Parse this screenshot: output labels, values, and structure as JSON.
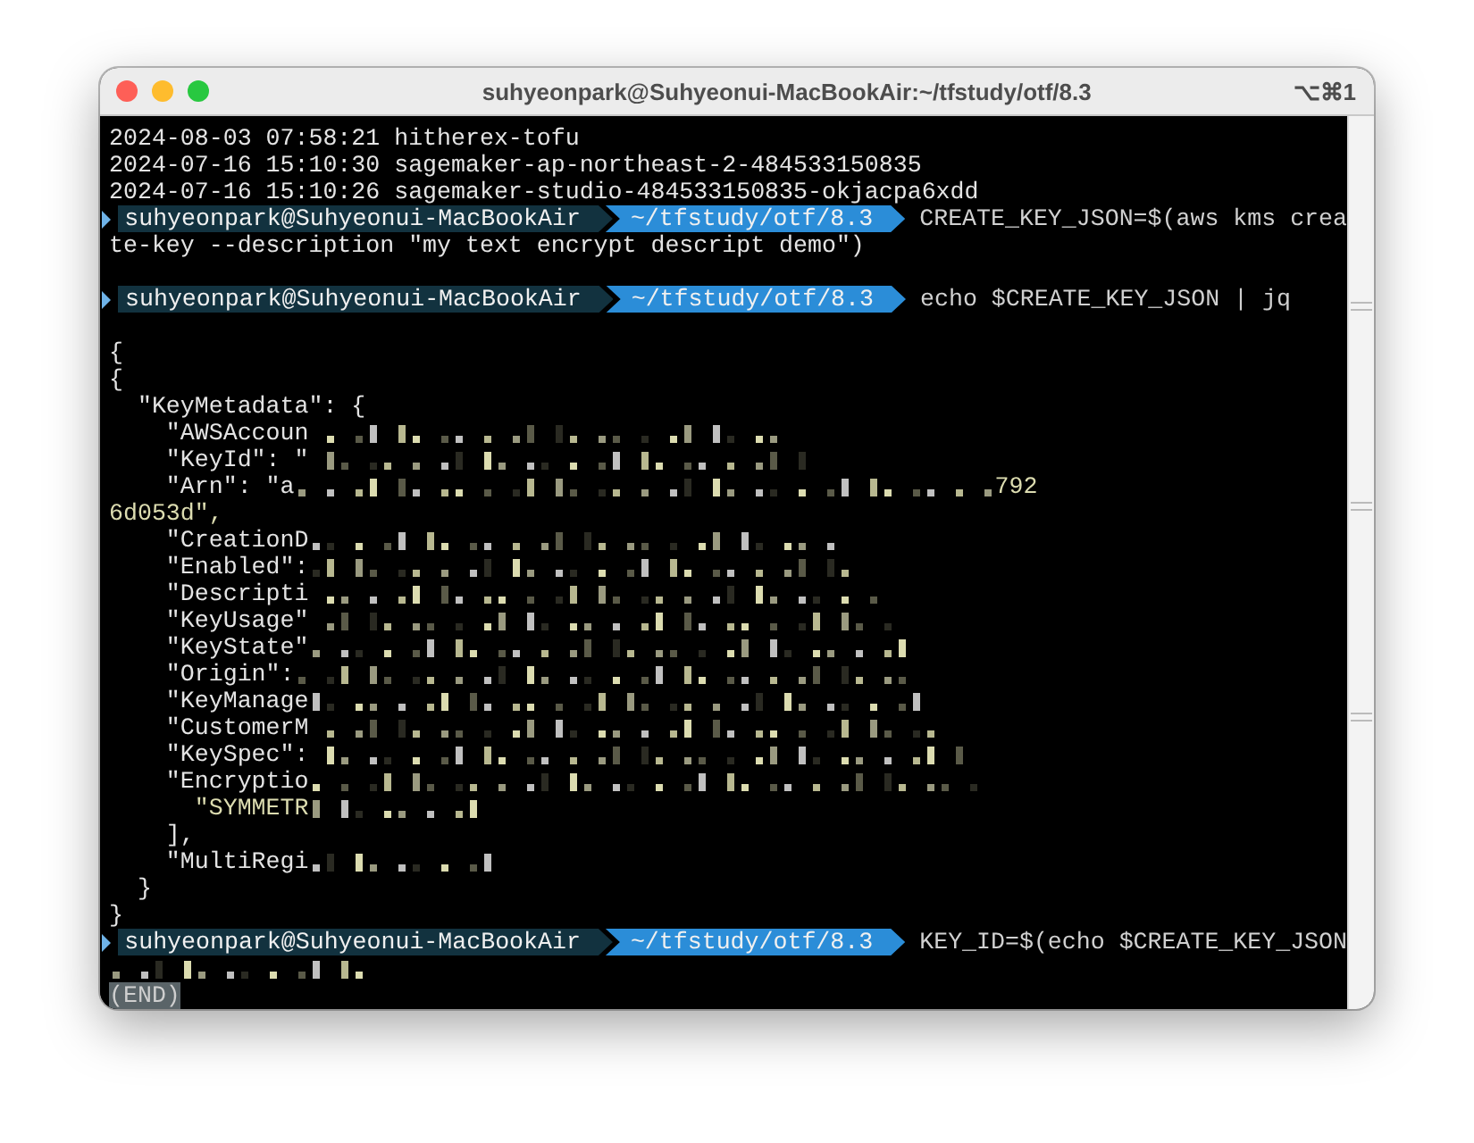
{
  "window": {
    "title": "suhyeonpark@Suhyeonui-MacBookAir:~/tfstudy/otf/8.3",
    "shortcut": "⌥⌘1"
  },
  "lines": [
    {
      "kind": "text",
      "text": "2024-08-03 07:58:21 hitherex-tofu",
      "highlighted": false
    },
    {
      "kind": "text",
      "text": "2024-07-16 15:10:30 sagemaker-ap-northeast-2-484533150835",
      "highlighted": false
    },
    {
      "kind": "text",
      "text": "2024-07-16 15:10:26 sagemaker-studio-484533150835-okjacpa6xdd",
      "highlighted": false
    },
    {
      "kind": "prompt",
      "user": "suhyeonpark@Suhyeonui-MacBookAir",
      "path": "~/tfstudy/otf/8.3",
      "command": "CREATE_KEY_JSON=$(aws kms crea"
    },
    {
      "kind": "text",
      "text": "te-key --description \"my text encrypt descript demo\")",
      "highlighted": false
    },
    {
      "kind": "blank"
    },
    {
      "kind": "prompt",
      "user": "suhyeonpark@Suhyeonui-MacBookAir",
      "path": "~/tfstudy/otf/8.3",
      "command": "echo $CREATE_KEY_JSON | jq"
    },
    {
      "kind": "blank"
    },
    {
      "kind": "text",
      "text": "{",
      "highlighted": false
    },
    {
      "kind": "text",
      "text": "{",
      "highlighted": false
    },
    {
      "kind": "text",
      "text": "  \"KeyMetadata\": {",
      "highlighted": false
    },
    {
      "kind": "redacted",
      "text": "    \"AWSAccoun",
      "highlighted": false
    },
    {
      "kind": "redacted",
      "text": "    \"KeyId\": \"",
      "highlighted": false
    },
    {
      "kind": "redacted",
      "text": "    \"Arn\": \"a",
      "highlighted": false,
      "suffix": "792"
    },
    {
      "kind": "text",
      "text": "6d053d\",",
      "highlighted": true
    },
    {
      "kind": "redacted",
      "text": "    \"CreationD",
      "highlighted": false
    },
    {
      "kind": "redacted",
      "text": "    \"Enabled\":",
      "highlighted": false
    },
    {
      "kind": "redacted",
      "text": "    \"Descripti",
      "highlighted": false
    },
    {
      "kind": "redacted",
      "text": "    \"KeyUsage\"",
      "highlighted": false
    },
    {
      "kind": "redacted",
      "text": "    \"KeyState\"",
      "highlighted": false
    },
    {
      "kind": "redacted",
      "text": "    \"Origin\":",
      "highlighted": false
    },
    {
      "kind": "redacted",
      "text": "    \"KeyManage",
      "highlighted": false
    },
    {
      "kind": "redacted",
      "text": "    \"CustomerM",
      "highlighted": false
    },
    {
      "kind": "redacted",
      "text": "    \"KeySpec\":",
      "highlighted": false
    },
    {
      "kind": "redacted",
      "text": "    \"Encryptio",
      "highlighted": false
    },
    {
      "kind": "redacted",
      "text": "      \"SYMMETR",
      "highlighted": true
    },
    {
      "kind": "text",
      "text": "    ],",
      "highlighted": false
    },
    {
      "kind": "redacted",
      "text": "    \"MultiRegi",
      "highlighted": false
    },
    {
      "kind": "text",
      "text": "  }",
      "highlighted": false
    },
    {
      "kind": "text",
      "text": "}",
      "highlighted": false
    },
    {
      "kind": "prompt",
      "user": "suhyeonpark@Suhyeonui-MacBookAir",
      "path": "~/tfstudy/otf/8.3",
      "command": "KEY_ID=$(echo $CREATE_KEY_JSON"
    },
    {
      "kind": "redacted"
    },
    {
      "kind": "pager",
      "text": "(END)"
    }
  ]
}
